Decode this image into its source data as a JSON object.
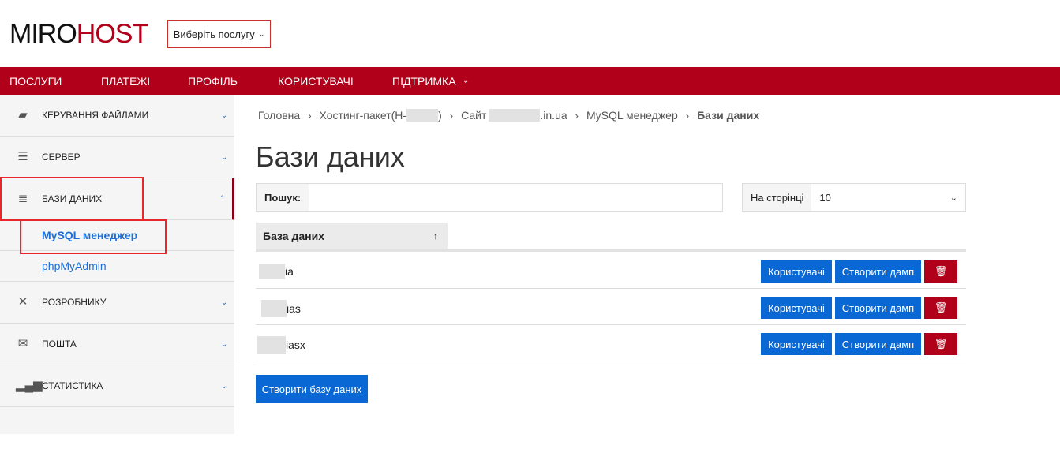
{
  "header": {
    "logo_part1": "MIRO",
    "logo_part2": "HOST",
    "service_select": "Виберіть послугу"
  },
  "nav": [
    "ПОСЛУГИ",
    "ПЛАТЕЖІ",
    "ПРОФІЛЬ",
    "КОРИСТУВАЧІ",
    "ПІДТРИМКА"
  ],
  "sidebar": {
    "items": [
      {
        "label": "КЕРУВАННЯ ФАЙЛАМИ",
        "icon": "folder-icon"
      },
      {
        "label": "СЕРВЕР",
        "icon": "server-icon"
      },
      {
        "label": "БАЗИ ДАНИХ",
        "icon": "database-icon",
        "expanded": true
      },
      {
        "label": "РОЗРОБНИКУ",
        "icon": "tools-icon"
      },
      {
        "label": "ПОШТА",
        "icon": "mail-icon"
      },
      {
        "label": "СТАТИСТИКА",
        "icon": "chart-icon"
      }
    ],
    "subitems": [
      "MySQL менеджер",
      "phpMyAdmin"
    ]
  },
  "breadcrumb": [
    "Головна",
    "Хостинг-пакет(Н-",
    ")",
    "Сайт",
    ".in.ua",
    "MySQL менеджер",
    "Бази даних"
  ],
  "title": "Бази даних",
  "search": {
    "label": "Пошук:",
    "value": ""
  },
  "per_page": {
    "label": "На сторінці",
    "value": "10"
  },
  "table": {
    "header": "База даних",
    "sort": "↑",
    "rows": [
      {
        "name_visible": "ia"
      },
      {
        "name_visible": "ias"
      },
      {
        "name_visible": "iasx"
      }
    ],
    "users_btn": "Користувачі",
    "dump_btn": "Створити дамп"
  },
  "create_btn": "Створити базу даних",
  "colors": {
    "brand": "#b0001a",
    "primary": "#0a68d4"
  }
}
